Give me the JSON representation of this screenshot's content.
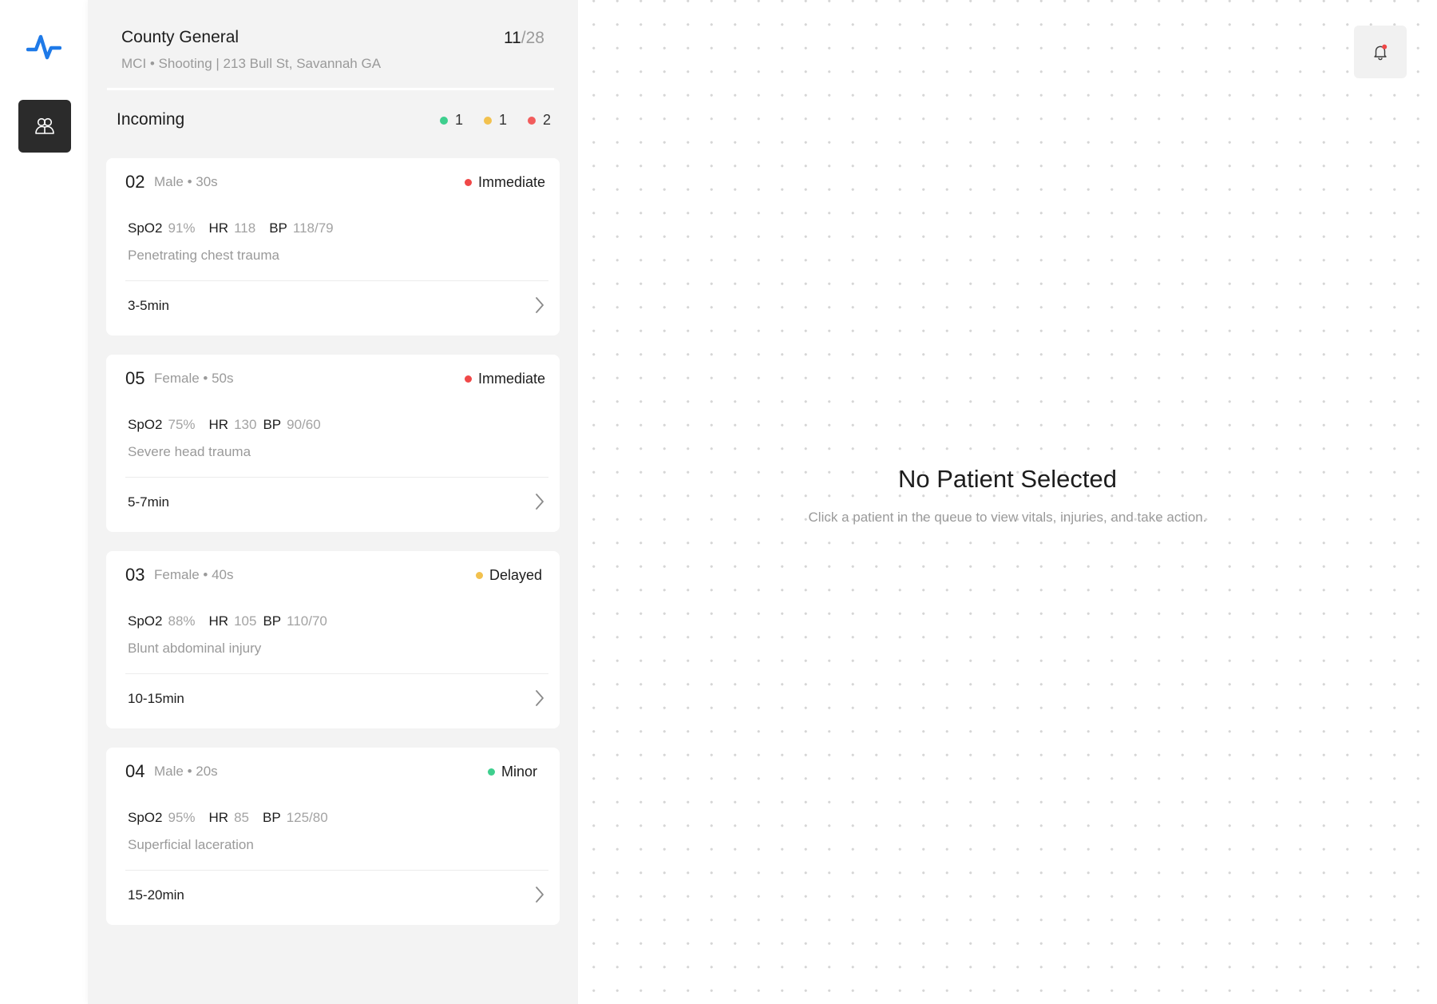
{
  "hospital": {
    "name": "County General",
    "incident": "MCI • Shooting | 213 Bull St, Savannah GA",
    "count_current": "11",
    "count_total": "/28"
  },
  "queue": {
    "title": "Incoming",
    "counts": [
      {
        "color": "#3ecf8e",
        "value": "1"
      },
      {
        "color": "#f2c14e",
        "value": "1"
      },
      {
        "color": "#f25c5c",
        "value": "2"
      }
    ]
  },
  "patients": [
    {
      "id": "02",
      "demo": "Male • 30s",
      "status": "Immediate",
      "status_color": "#f04848",
      "vitals": {
        "spo2_label": "SpO2",
        "spo2": "91%",
        "hr_label": "HR",
        "hr": "118",
        "bp_label": "BP",
        "bp": "118/79"
      },
      "injury": "Penetrating chest trauma",
      "eta": "3-5min"
    },
    {
      "id": "05",
      "demo": "Female • 50s",
      "status": "Immediate",
      "status_color": "#f04848",
      "vitals": {
        "spo2_label": "SpO2",
        "spo2": "75%",
        "hr_label": "HR",
        "hr": "130",
        "bp_label": "BP",
        "bp": "90/60"
      },
      "injury": "Severe head trauma",
      "eta": "5-7min"
    },
    {
      "id": "03",
      "demo": "Female • 40s",
      "status": "Delayed",
      "status_color": "#f2c14e",
      "vitals": {
        "spo2_label": "SpO2",
        "spo2": "88%",
        "hr_label": "HR",
        "hr": "105",
        "bp_label": "BP",
        "bp": "110/70"
      },
      "injury": "Blunt abdominal injury",
      "eta": "10-15min"
    },
    {
      "id": "04",
      "demo": "Male • 20s",
      "status": "Minor",
      "status_color": "#3ecf8e",
      "vitals": {
        "spo2_label": "SpO2",
        "spo2": "95%",
        "hr_label": "HR",
        "hr": "85",
        "bp_label": "BP",
        "bp": "125/80"
      },
      "injury": "Superficial laceration",
      "eta": "15-20min"
    }
  ],
  "empty_state": {
    "title": "No Patient Selected",
    "subtitle": "Click a patient in the queue to view vitals, injuries, and take action."
  },
  "icons": {
    "logo": "pulse-logo-icon",
    "nav": "patients-icon",
    "notifications": "bell-icon",
    "card_action": "chevron-right-icon"
  },
  "colors": {
    "accent": "#1f7ae8",
    "notification_dot": "#f04848"
  }
}
